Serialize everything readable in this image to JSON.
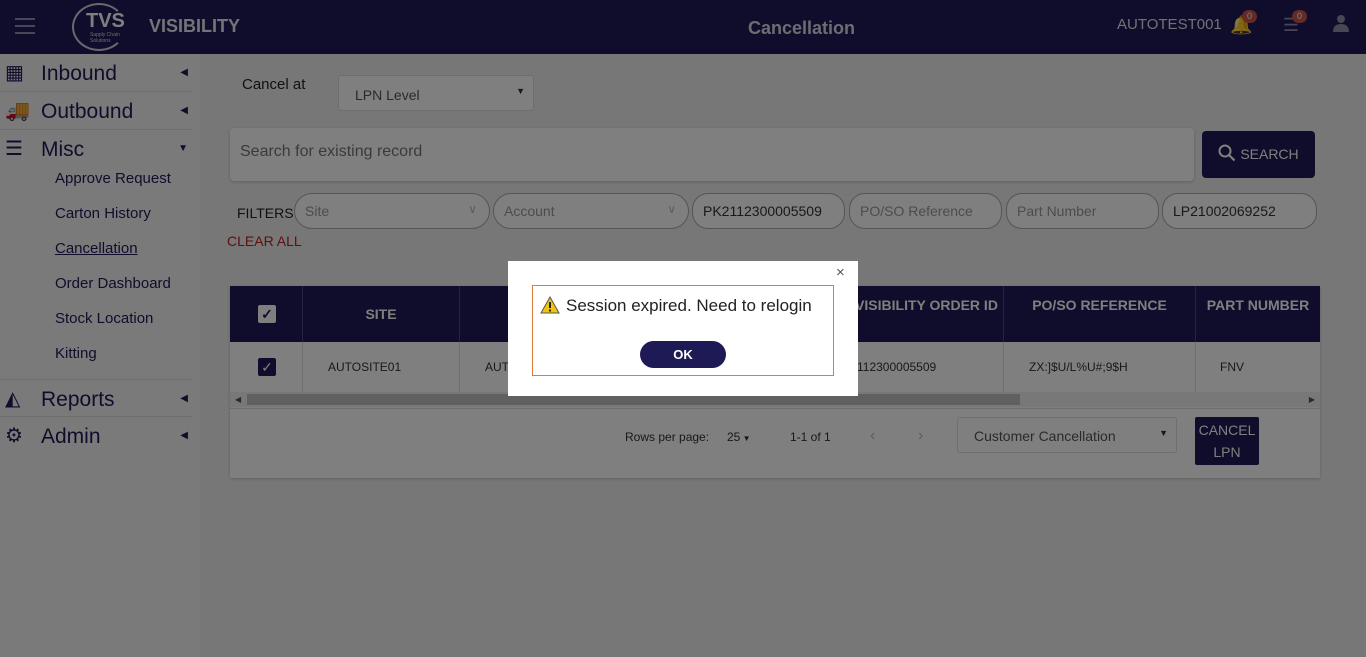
{
  "topbar": {
    "logo_text": "TVS",
    "logo_subtext": "Supply Chain Solutions",
    "brand": "VISIBILITY",
    "page_title": "Cancellation",
    "username": "AUTOTEST001",
    "notification_count": "0",
    "tasks_count": "0"
  },
  "sidebar": {
    "inbound": "Inbound",
    "outbound": "Outbound",
    "misc": "Misc",
    "misc_items": [
      "Approve Request",
      "Carton History",
      "Cancellation",
      "Order Dashboard",
      "Stock Location",
      "Kitting"
    ],
    "reports": "Reports",
    "admin": "Admin"
  },
  "form": {
    "cancel_at_label": "Cancel at",
    "cancel_at_value": "LPN Level",
    "search_placeholder": "Search for existing record",
    "search_button": "SEARCH",
    "filters_label": "FILTERS",
    "clear_all": "CLEAR ALL",
    "site_placeholder": "Site",
    "account_placeholder": "Account",
    "pick_value": "PK2112300005509",
    "poso_placeholder": "PO/SO Reference",
    "part_placeholder": "Part Number",
    "lpn_value": "LP21002069252"
  },
  "table": {
    "headers": [
      "SITE",
      "",
      "VISIBILITY ORDER ID",
      "PO/SO REFERENCE",
      "PART NUMBER"
    ],
    "row": {
      "site": "AUTOSITE01",
      "account": "AUTO",
      "order_id": "112300005509",
      "poso": "ZX:]$U/L%U#;9$H",
      "part": "FNV"
    }
  },
  "pager": {
    "rows_per_page_label": "Rows per page:",
    "rows_per_page_value": "25",
    "range": "1-1 of 1",
    "reason_value": "Customer Cancellation",
    "cancel_lpn_button": "CANCEL LPN"
  },
  "modal": {
    "message": "Session expired. Need to relogin",
    "ok_button": "OK",
    "close": "×"
  },
  "colors": {
    "primary": "#1e1a56",
    "danger": "#c31d1d",
    "warning_border": "#e07b39",
    "badge": "#c9574d"
  }
}
